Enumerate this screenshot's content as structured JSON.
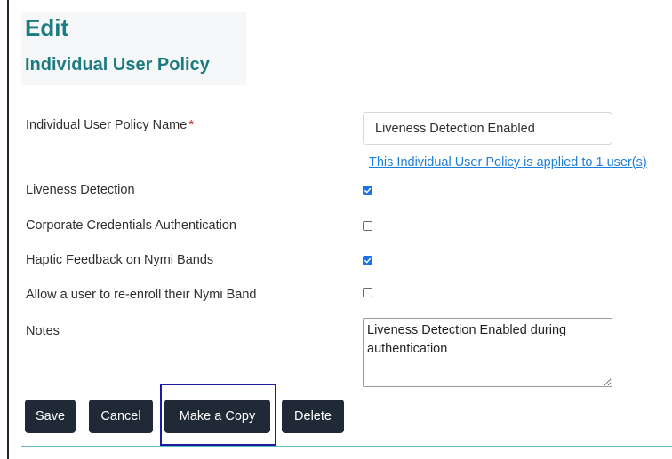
{
  "header": {
    "title": "Edit",
    "subtitle": "Individual User Policy"
  },
  "form": {
    "policy_name": {
      "label": "Individual User Policy Name",
      "required_marker": "*",
      "value": "Liveness Detection Enabled"
    },
    "applied_link": "This Individual User Policy is applied to 1 user(s)",
    "options": [
      {
        "label": "Liveness Detection",
        "checked": true
      },
      {
        "label": "Corporate Credentials Authentication",
        "checked": false
      },
      {
        "label": "Haptic Feedback on Nymi Bands",
        "checked": true
      },
      {
        "label": "Allow a user to re-enroll their Nymi Band",
        "checked": false
      }
    ],
    "notes": {
      "label": "Notes",
      "value": "Liveness Detection Enabled during authentication"
    }
  },
  "actions": {
    "save_label": "Save",
    "cancel_label": "Cancel",
    "copy_label": "Make a Copy",
    "delete_label": "Delete"
  },
  "colors": {
    "accent": "#1b7b80",
    "button_bg": "#1f2a36",
    "link": "#1e7fd8",
    "checkbox_checked": "#1a73e8",
    "required": "#d11a1a",
    "highlight_border": "#1c1d9e"
  }
}
